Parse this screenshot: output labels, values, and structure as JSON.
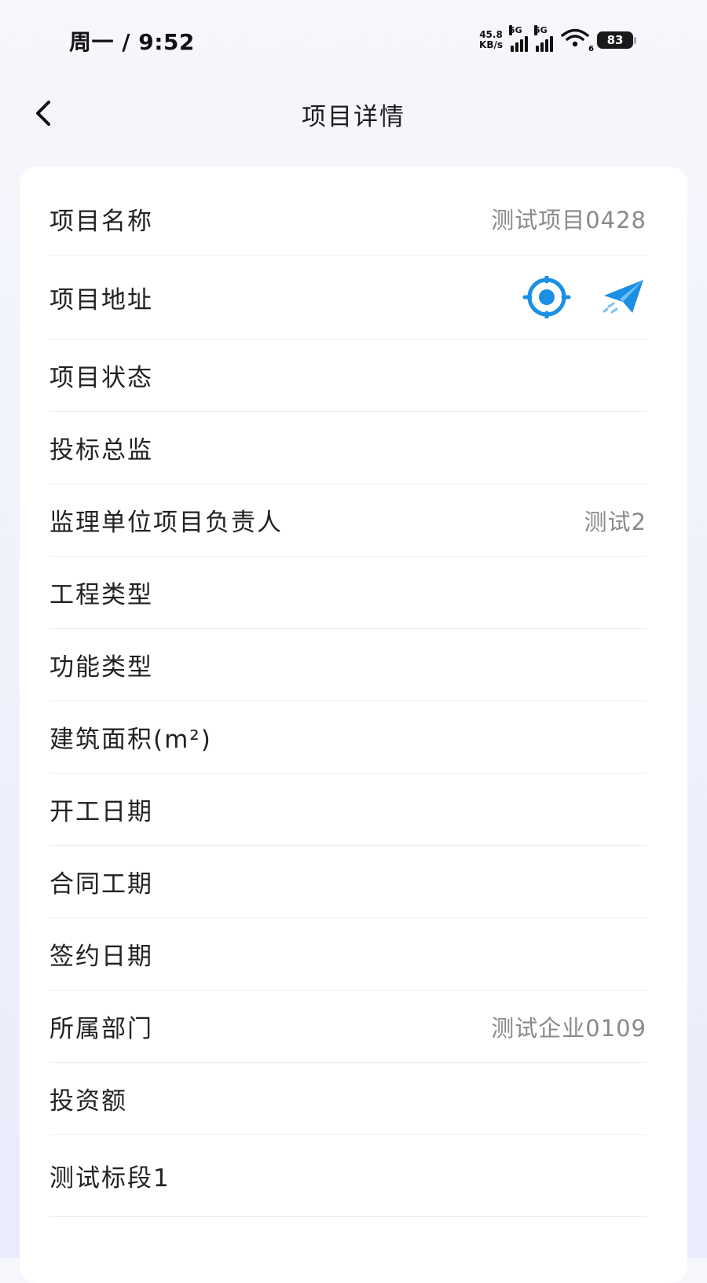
{
  "status_bar": {
    "time": "周一 / 9:52",
    "net_speed_value": "45.8",
    "net_speed_unit": "KB/s",
    "signal1_tag": "5G",
    "signal2_tag": "5G",
    "wifi_sub": "6",
    "battery": "83"
  },
  "header": {
    "title": "项目详情"
  },
  "rows": [
    {
      "label": "项目名称",
      "value": "测试项目0428"
    },
    {
      "label": "项目地址",
      "value": ""
    },
    {
      "label": "项目状态",
      "value": ""
    },
    {
      "label": "投标总监",
      "value": ""
    },
    {
      "label": "监理单位项目负责人",
      "value": "测试2"
    },
    {
      "label": "工程类型",
      "value": ""
    },
    {
      "label": "功能类型",
      "value": ""
    },
    {
      "label": "建筑面积(m²)",
      "value": ""
    },
    {
      "label": "开工日期",
      "value": ""
    },
    {
      "label": "合同工期",
      "value": ""
    },
    {
      "label": "签约日期",
      "value": ""
    },
    {
      "label": "所属部门",
      "value": "测试企业0109"
    },
    {
      "label": "投资额",
      "value": ""
    },
    {
      "label": "测试标段1",
      "value": ""
    }
  ],
  "colors": {
    "accent": "#1a8fe3",
    "label": "#222222",
    "value": "#8a8a8a"
  },
  "icons": {
    "back": "chevron-left-icon",
    "locate": "locate-target-icon",
    "navigate": "paper-plane-icon"
  }
}
